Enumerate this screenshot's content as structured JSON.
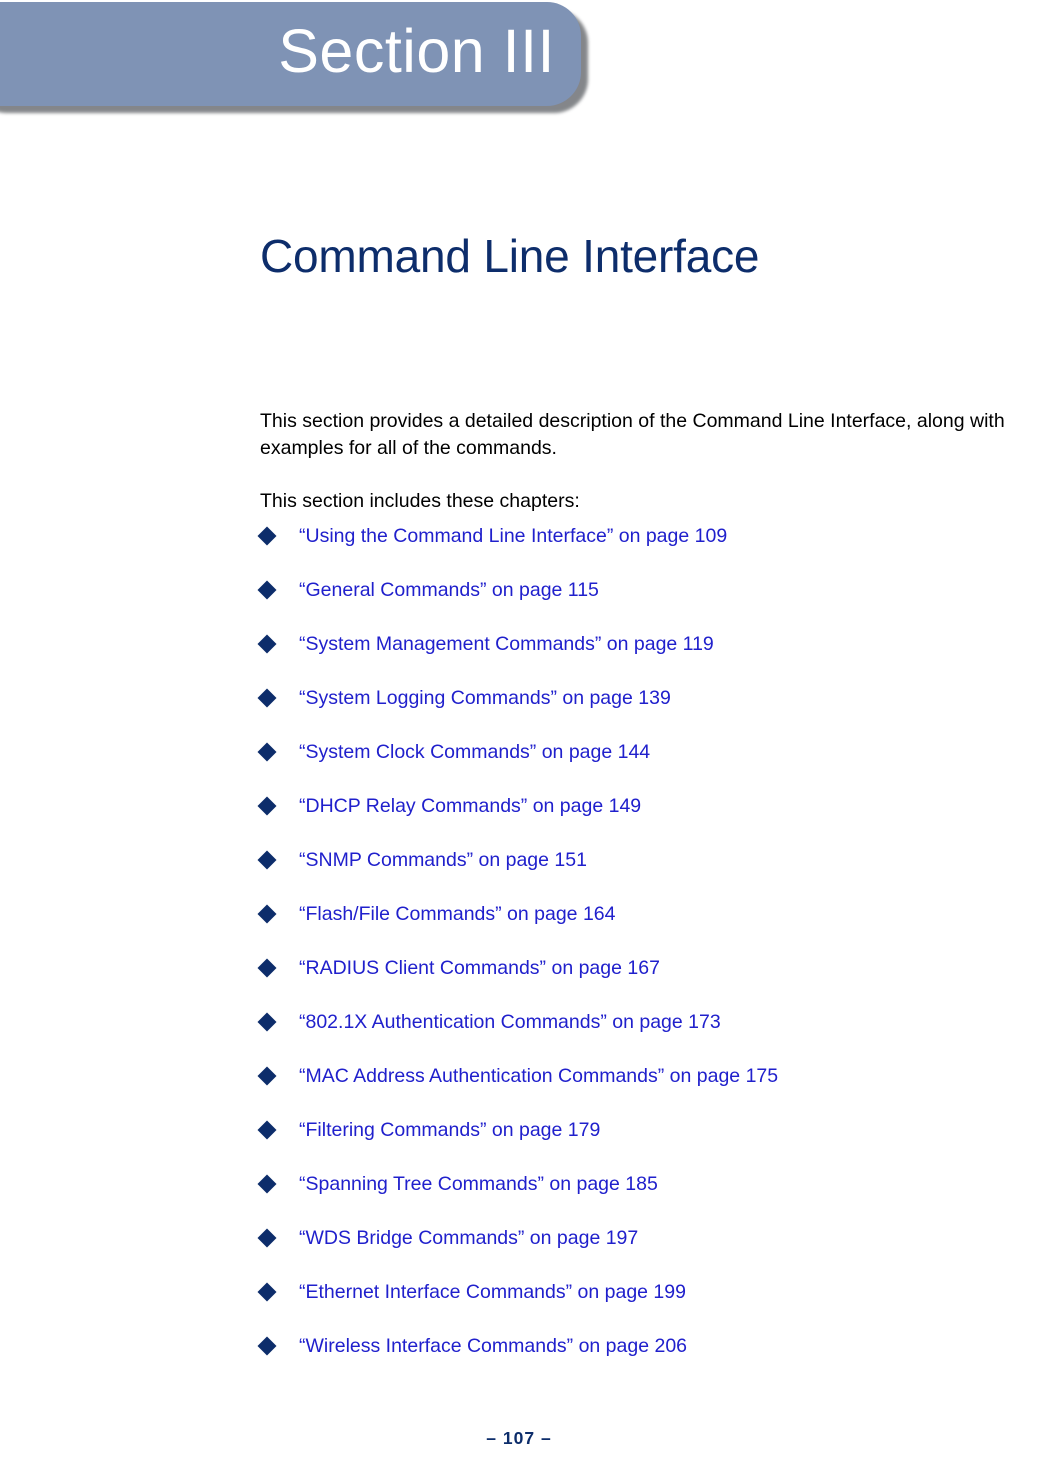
{
  "section_tab": {
    "label": "Section III",
    "fill_color": "#7f93b5",
    "text_color": "#ffffff",
    "shadow_color": "#6f7276"
  },
  "title": "Command Line Interface",
  "title_color": "#0d2d6b",
  "body": {
    "intro_paragraph": "This section provides a detailed description of the Command Line Interface, along with examples for all of the commands.",
    "list_lead_in": "This section includes these chapters:",
    "text_color": "#000000"
  },
  "list_style": {
    "bullet_glyph": "diamond-bullet",
    "bullet_color": "#0d2d6b",
    "link_color": "#2020cc"
  },
  "chapters": [
    {
      "label": "“Using the Command Line Interface” on page 109",
      "title": "Using the Command Line Interface",
      "page": "109"
    },
    {
      "label": "“General Commands” on page 115",
      "title": "General Commands",
      "page": "115"
    },
    {
      "label": "“System Management Commands” on page 119",
      "title": "System Management Commands",
      "page": "119"
    },
    {
      "label": "“System Logging Commands” on page 139",
      "title": "System Logging Commands",
      "page": "139"
    },
    {
      "label": "“System Clock Commands” on page 144",
      "title": "System Clock Commands",
      "page": "144"
    },
    {
      "label": "“DHCP Relay Commands” on page 149",
      "title": "DHCP Relay Commands",
      "page": "149"
    },
    {
      "label": "“SNMP Commands” on page 151",
      "title": "SNMP Commands",
      "page": "151"
    },
    {
      "label": "“Flash/File Commands” on page 164",
      "title": "Flash/File Commands",
      "page": "164"
    },
    {
      "label": "“RADIUS Client Commands” on page 167",
      "title": "RADIUS Client Commands",
      "page": "167"
    },
    {
      "label": "“802.1X Authentication Commands” on page 173",
      "title": "802.1X Authentication Commands",
      "page": "173"
    },
    {
      "label": "“MAC Address Authentication Commands” on page 175",
      "title": "MAC Address Authentication Commands",
      "page": "175"
    },
    {
      "label": "“Filtering Commands” on page 179",
      "title": "Filtering Commands",
      "page": "179"
    },
    {
      "label": "“Spanning Tree Commands” on page 185",
      "title": "Spanning Tree Commands",
      "page": "185"
    },
    {
      "label": "“WDS Bridge Commands” on page 197",
      "title": "WDS Bridge Commands",
      "page": "197"
    },
    {
      "label": "“Ethernet Interface Commands” on page 199",
      "title": "Ethernet Interface Commands",
      "page": "199"
    },
    {
      "label": "“Wireless Interface Commands” on page 206",
      "title": "Wireless Interface Commands",
      "page": "206"
    }
  ],
  "footer": {
    "page_number": "–  107  –",
    "color": "#0d2d6b"
  }
}
